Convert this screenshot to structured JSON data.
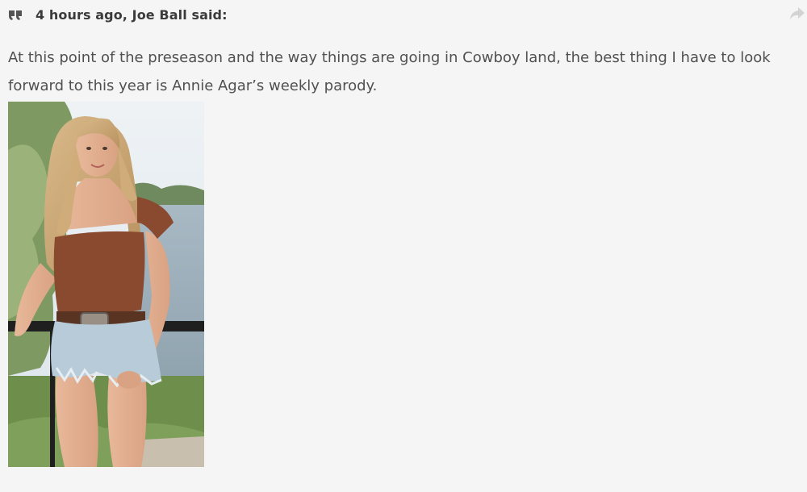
{
  "quote": {
    "icon": "quote-icon",
    "attribution": "4 hours ago, Joe Ball said:",
    "share_icon": "share-arrow-icon",
    "body": "At this point of the preseason and the way things are going in Cowboy land, the best thing I have to look forward to this year is Annie Agar’s weekly parody.",
    "image": {
      "subject": "photo-woman-brown-top-denim-shorts-balcony"
    }
  },
  "colors": {
    "background": "#f5f5f5",
    "text": "#505050",
    "header_text": "#3b3b3b",
    "icon": "#555555",
    "share_icon": "#d3d3d3"
  }
}
